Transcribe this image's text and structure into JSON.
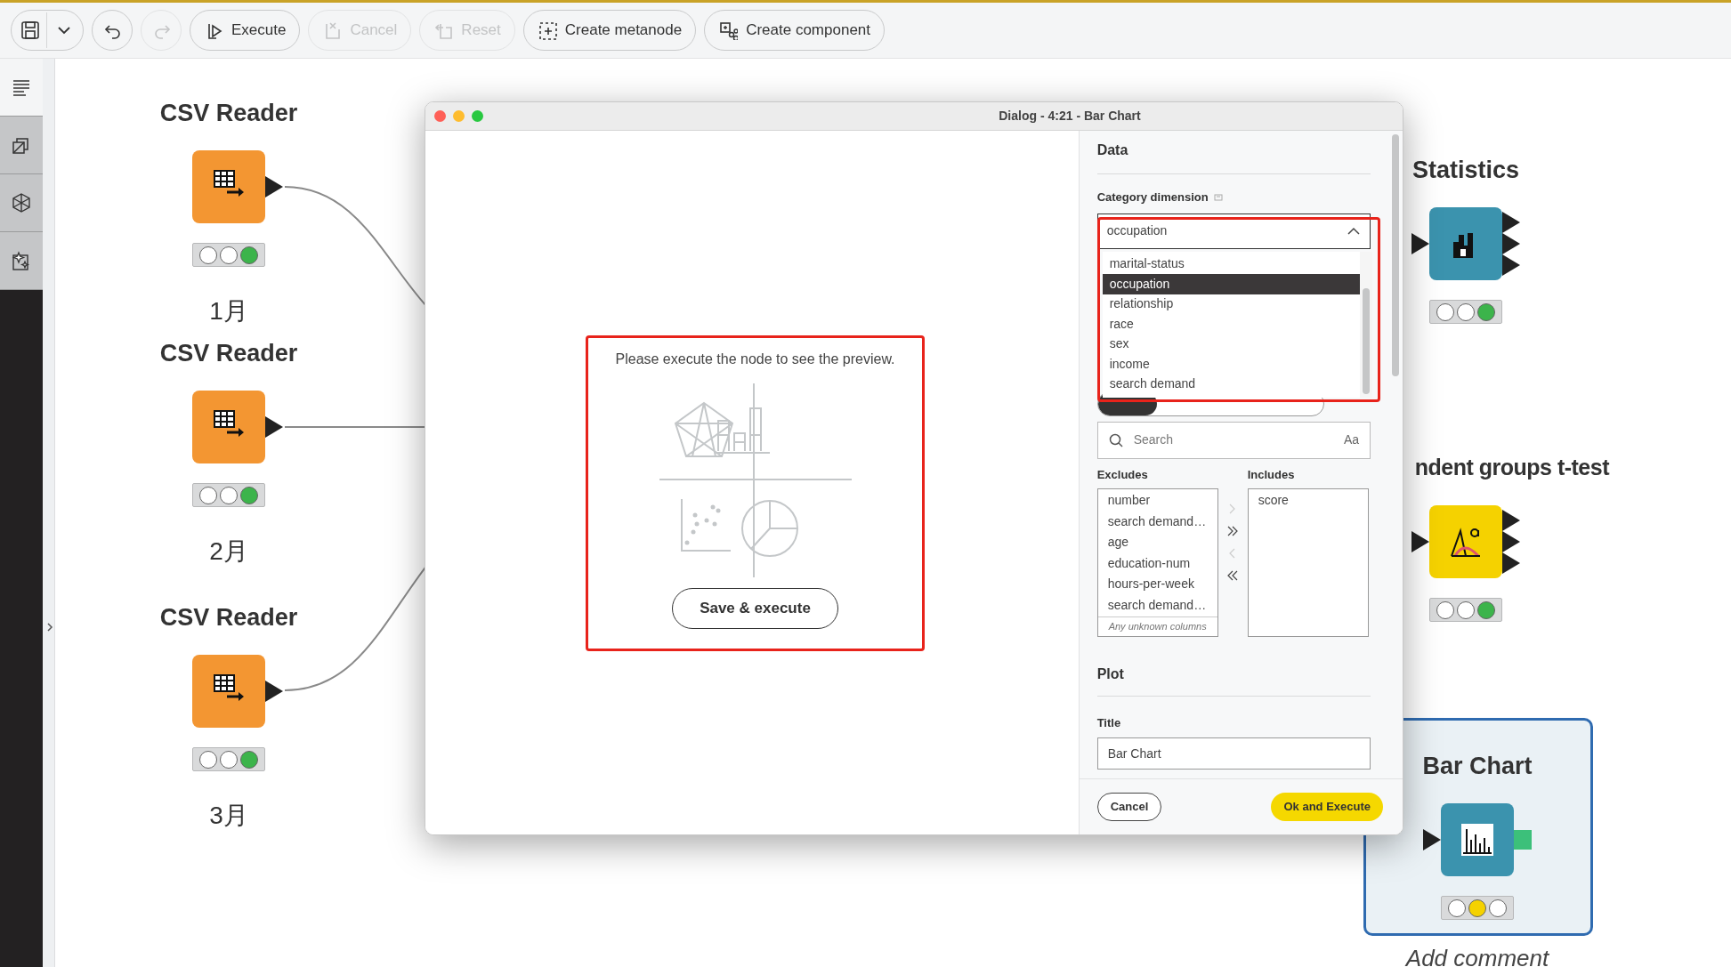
{
  "toolbar": {
    "buttons": [
      {
        "kind": "save",
        "disabled": false
      },
      {
        "kind": "menu",
        "disabled": false
      },
      {
        "kind": "undo",
        "disabled": false
      },
      {
        "kind": "redo",
        "disabled": true
      },
      {
        "kind": "execute",
        "label": "Execute",
        "disabled": false
      },
      {
        "kind": "cancel",
        "label": "Cancel",
        "disabled": true
      },
      {
        "kind": "reset",
        "label": "Reset",
        "disabled": true
      },
      {
        "kind": "metanode",
        "label": "Create metanode",
        "disabled": false
      },
      {
        "kind": "component",
        "label": "Create component",
        "disabled": false
      }
    ]
  },
  "sidebar": {
    "items": [
      {
        "kind": "description",
        "selected": true
      },
      {
        "kind": "spaces",
        "selected": false
      },
      {
        "kind": "repository",
        "selected": false
      },
      {
        "kind": "assistant",
        "selected": false
      }
    ]
  },
  "canvas": {
    "nodes": [
      {
        "kind": "csv_reader",
        "title": "CSV Reader",
        "executed": true,
        "label": "1月"
      },
      {
        "kind": "csv_reader",
        "title": "CSV Reader",
        "executed": true,
        "label": "2月"
      },
      {
        "kind": "csv_reader",
        "title": "CSV Reader",
        "executed": true,
        "label": "3月"
      },
      {
        "kind": "statistics",
        "title": "Statistics",
        "executed": true
      },
      {
        "kind": "t_test",
        "title": "ndent groups t-test",
        "executed": true
      },
      {
        "kind": "bar_chart",
        "title": "Bar Chart",
        "executed": false,
        "framed": true,
        "label": "Add comment"
      }
    ]
  },
  "dialog": {
    "title": "Dialog - 4:21 - Bar Chart",
    "preview": {
      "message": "Please execute the node to see the preview.",
      "button": "Save & execute"
    },
    "sections": {
      "data": "Data",
      "plot": "Plot"
    },
    "category_dimension": {
      "label": "Category dimension",
      "value": "occupation",
      "expanded": true,
      "options": [
        {
          "label": "marital-status",
          "selected": false
        },
        {
          "label": "occupation",
          "selected": true
        },
        {
          "label": "relationship",
          "selected": false
        },
        {
          "label": "race",
          "selected": false
        },
        {
          "label": "sex",
          "selected": false
        },
        {
          "label": "income",
          "selected": false
        },
        {
          "label": "search demand",
          "selected": false
        }
      ]
    },
    "search": {
      "placeholder": "Search",
      "case_toggle": "Aa"
    },
    "excludes": {
      "label": "Excludes",
      "items": [
        "number",
        "search demand…",
        "age",
        "education-num",
        "hours-per-week",
        "search demand…"
      ],
      "footer": "Any unknown columns"
    },
    "includes": {
      "label": "Includes",
      "items": [
        "score"
      ]
    },
    "transfer_buttons": [
      {
        "kind": "add",
        "disabled": true
      },
      {
        "kind": "add_all",
        "disabled": false
      },
      {
        "kind": "remove",
        "disabled": true
      },
      {
        "kind": "remove_all",
        "disabled": false
      }
    ],
    "title_field": {
      "label": "Title",
      "value": "Bar Chart"
    },
    "footer": {
      "cancel": "Cancel",
      "ok": "Ok and Execute"
    }
  }
}
